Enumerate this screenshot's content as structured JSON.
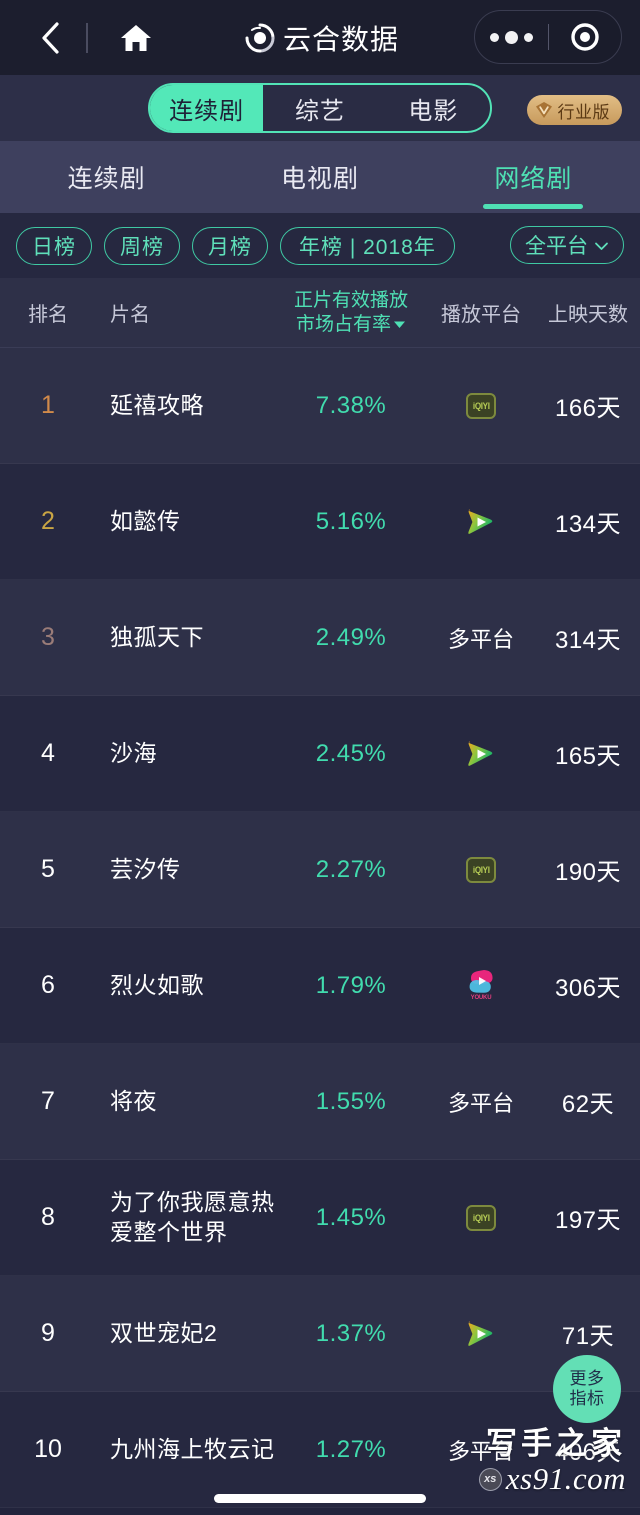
{
  "navbar": {
    "back_icon": "chevron-left-icon",
    "home_icon": "home-icon",
    "logo_icon": "yunhe-logo-icon",
    "title": "云合数据",
    "capsule": {
      "more_icon": "more-dots-icon",
      "target_icon": "target-circle-icon"
    }
  },
  "segmented": {
    "items": [
      {
        "label": "连续剧",
        "active": true
      },
      {
        "label": "综艺",
        "active": false
      },
      {
        "label": "电影",
        "active": false
      }
    ],
    "pro_badge": {
      "icon": "v-diamond-icon",
      "label": "行业版"
    }
  },
  "subtabs": [
    {
      "label": "连续剧",
      "active": false
    },
    {
      "label": "电视剧",
      "active": false
    },
    {
      "label": "网络剧",
      "active": true
    }
  ],
  "filters": {
    "chips": [
      {
        "label": "日榜",
        "active": false
      },
      {
        "label": "周榜",
        "active": false
      },
      {
        "label": "月榜",
        "active": false
      },
      {
        "label": "年榜 | 2018年",
        "active": true
      }
    ],
    "platform_select": {
      "label": "全平台",
      "icon": "chevron-down-icon"
    }
  },
  "table": {
    "headers": {
      "rank": "排名",
      "title": "片名",
      "share_line1": "正片有效播放",
      "share_line2": "市场占有率",
      "share_sort_icon": "sort-desc-caret-icon",
      "platform": "播放平台",
      "days": "上映天数"
    },
    "rows": [
      {
        "rank": "1",
        "title": "延禧攻略",
        "share": "7.38%",
        "platform": "iqiyi",
        "platform_label": "",
        "days": "166天"
      },
      {
        "rank": "2",
        "title": "如懿传",
        "share": "5.16%",
        "platform": "tencent",
        "platform_label": "",
        "days": "134天"
      },
      {
        "rank": "3",
        "title": "独孤天下",
        "share": "2.49%",
        "platform": "text",
        "platform_label": "多平台",
        "days": "314天"
      },
      {
        "rank": "4",
        "title": "沙海",
        "share": "2.45%",
        "platform": "tencent",
        "platform_label": "",
        "days": "165天"
      },
      {
        "rank": "5",
        "title": "芸汐传",
        "share": "2.27%",
        "platform": "iqiyi",
        "platform_label": "",
        "days": "190天"
      },
      {
        "rank": "6",
        "title": "烈火如歌",
        "share": "1.79%",
        "platform": "youku",
        "platform_label": "",
        "days": "306天"
      },
      {
        "rank": "7",
        "title": "将夜",
        "share": "1.55%",
        "platform": "text",
        "platform_label": "多平台",
        "days": "62天"
      },
      {
        "rank": "8",
        "title": "为了你我愿意热爱整个世界",
        "share": "1.45%",
        "platform": "iqiyi",
        "platform_label": "",
        "days": "197天"
      },
      {
        "rank": "9",
        "title": "双世宠妃2",
        "share": "1.37%",
        "platform": "tencent",
        "platform_label": "",
        "days": "71天"
      },
      {
        "rank": "10",
        "title": "九州海上牧云记",
        "share": "1.27%",
        "platform": "text",
        "platform_label": "多平台",
        "days": "406天"
      }
    ]
  },
  "fab": {
    "line1": "更多",
    "line2": "指标"
  },
  "watermark": {
    "cn": "写手之家",
    "badge": "xs",
    "domain": "xs91.com"
  },
  "colors": {
    "accent": "#4FE0B4",
    "page_bg": "#22243C",
    "row_odd": "#2E3048",
    "row_even": "#262840",
    "rank1": "#D18A4A",
    "rank2": "#C9A544",
    "rank3": "#9A7C78",
    "gold": "#C79A5C"
  }
}
